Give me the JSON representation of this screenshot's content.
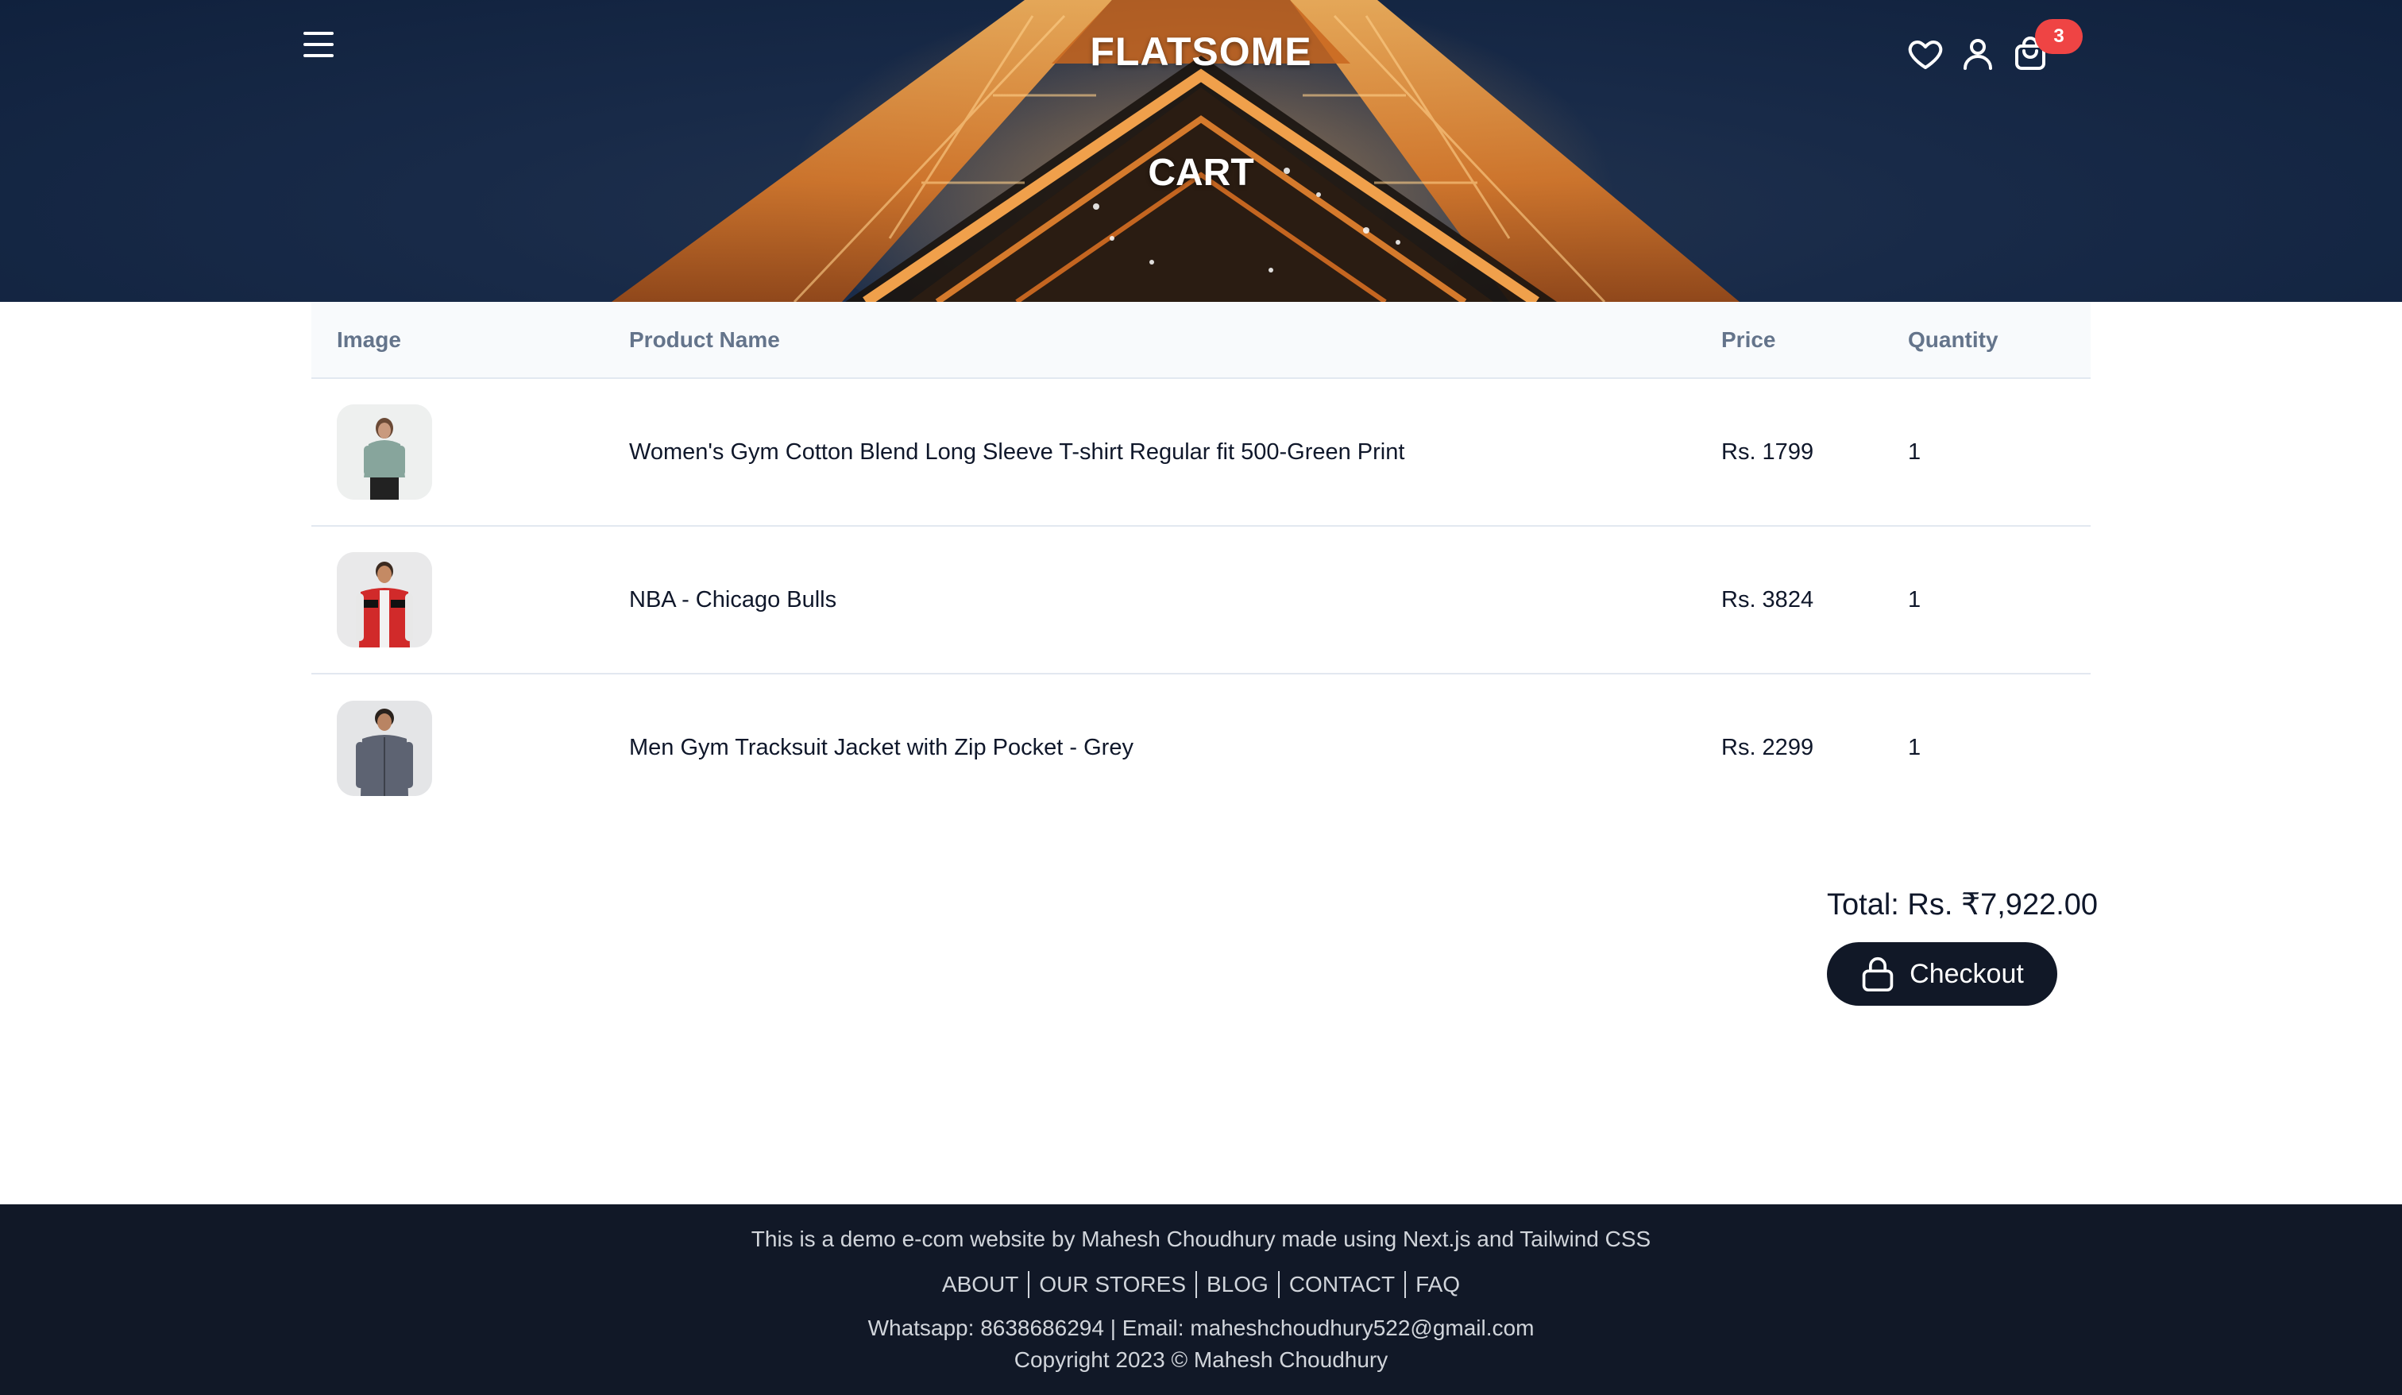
{
  "header": {
    "brand": "FLATSOME",
    "page_title": "CART",
    "cart_count": "3",
    "icons": [
      "menu-icon",
      "heart-icon",
      "user-icon",
      "shopping-bag-icon"
    ]
  },
  "table": {
    "columns": [
      "Image",
      "Product Name",
      "Price",
      "Quantity"
    ],
    "rows": [
      {
        "name": "Women's Gym Cotton Blend Long Sleeve T-shirt Regular fit 500-Green Print",
        "price": "Rs. 1799",
        "quantity": "1",
        "image": "woman-green-tshirt"
      },
      {
        "name": "NBA - Chicago Bulls",
        "price": "Rs. 3824",
        "quantity": "1",
        "image": "man-red-bulls-jacket"
      },
      {
        "name": "Men Gym Tracksuit Jacket with Zip Pocket - Grey",
        "price": "Rs. 2299",
        "quantity": "1",
        "image": "man-grey-jacket"
      }
    ]
  },
  "summary": {
    "total": "Total: Rs. ₹7,922.00",
    "checkout_label": "Checkout"
  },
  "footer": {
    "tagline": "This is a demo e-com website by Mahesh Choudhury made using Next.js and Tailwind CSS",
    "links": [
      "ABOUT",
      "OUR STORES",
      "BLOG",
      "CONTACT",
      "FAQ"
    ],
    "contact": "Whatsapp: 8638686294 | Email: maheshchoudhury522@gmail.com",
    "copyright": "Copyright 2023 © Mahesh Choudhury"
  },
  "colors": {
    "hero_bg": "#182a48",
    "badge": "#ef4444",
    "button": "#111827",
    "footer_bg": "#111827"
  }
}
